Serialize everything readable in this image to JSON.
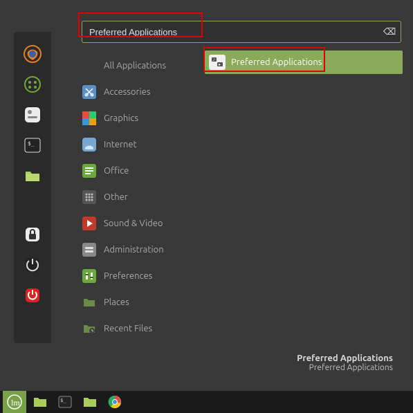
{
  "search": {
    "value": "Preferred Applications",
    "clear_glyph": "⌫"
  },
  "categories": [
    {
      "label": "All Applications",
      "icon": "all"
    },
    {
      "label": "Accessories",
      "icon": "scissors"
    },
    {
      "label": "Graphics",
      "icon": "graphics"
    },
    {
      "label": "Internet",
      "icon": "internet"
    },
    {
      "label": "Office",
      "icon": "office"
    },
    {
      "label": "Other",
      "icon": "other"
    },
    {
      "label": "Sound & Video",
      "icon": "media"
    },
    {
      "label": "Administration",
      "icon": "admin"
    },
    {
      "label": "Preferences",
      "icon": "prefs"
    },
    {
      "label": "Places",
      "icon": "places"
    },
    {
      "label": "Recent Files",
      "icon": "recent"
    }
  ],
  "results": [
    {
      "label": "Preferred Applications",
      "icon": "pref-apps"
    }
  ],
  "selection": {
    "title": "Preferred Applications",
    "subtitle": "Preferred Applications"
  },
  "favorites": [
    {
      "name": "firefox"
    },
    {
      "name": "software"
    },
    {
      "name": "settings"
    },
    {
      "name": "terminal"
    },
    {
      "name": "files"
    }
  ]
}
